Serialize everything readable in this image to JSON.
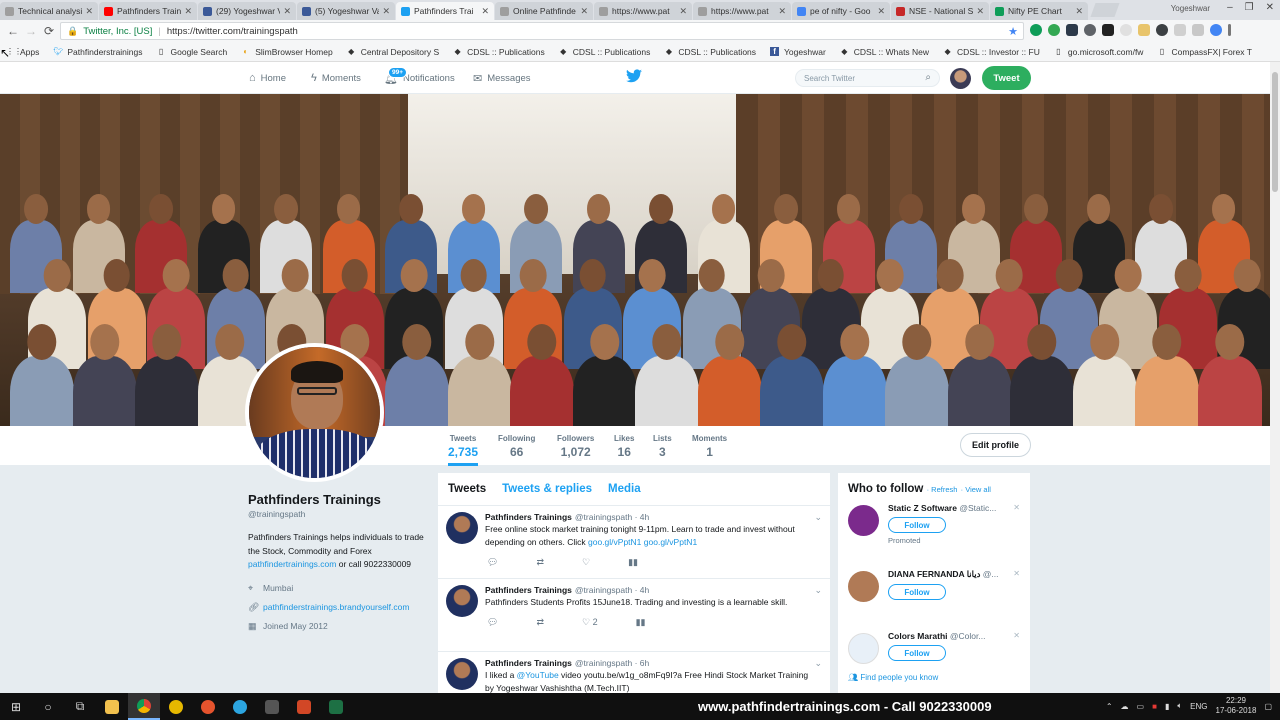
{
  "browser": {
    "tabs": [
      {
        "label": "Technical analysis",
        "icon_color": "#9e9e9e",
        "active": false
      },
      {
        "label": "Pathfinders Train",
        "icon_color": "#ff0000",
        "active": false
      },
      {
        "label": "(29) Yogeshwar V",
        "icon_color": "#3b5998",
        "active": false
      },
      {
        "label": "(5) Yogeshwar Va",
        "icon_color": "#3b5998",
        "active": false
      },
      {
        "label": "Pathfinders Trai",
        "icon_color": "#1da1f2",
        "active": true
      },
      {
        "label": "Online Pathfinde",
        "icon_color": "#9e9e9e",
        "active": false
      },
      {
        "label": "https://www.pat",
        "icon_color": "#9e9e9e",
        "active": false
      },
      {
        "label": "https://www.pat",
        "icon_color": "#9e9e9e",
        "active": false
      },
      {
        "label": "pe of nifty - Goo",
        "icon_color": "#4285f4",
        "active": false
      },
      {
        "label": "NSE - National S",
        "icon_color": "#c62828",
        "active": false
      },
      {
        "label": "Nifty PE Chart",
        "icon_color": "#0f9d58",
        "active": false
      }
    ],
    "profile_name": "Yogeshwar",
    "window_controls": [
      "–",
      "❐",
      "✕"
    ],
    "url_secure_label": "Twitter, Inc. [US]",
    "url": "https://twitter.com/trainingspath",
    "bookmarks": [
      {
        "label": "Apps",
        "icon": "apps-grid-icon"
      },
      {
        "label": "Pathfinderstrainings",
        "icon": "twitter-icon"
      },
      {
        "label": "Google Search",
        "icon": "page-icon"
      },
      {
        "label": "SlimBrowser Homep",
        "icon": "slimbrowser-icon"
      },
      {
        "label": "Central Depository S",
        "icon": "diamond-icon"
      },
      {
        "label": "CDSL :: Publications",
        "icon": "diamond-icon"
      },
      {
        "label": "CDSL :: Publications",
        "icon": "diamond-icon"
      },
      {
        "label": "CDSL :: Publications",
        "icon": "diamond-icon"
      },
      {
        "label": "Yogeshwar",
        "icon": "facebook-icon"
      },
      {
        "label": "CDSL :: Whats New",
        "icon": "diamond-icon"
      },
      {
        "label": "CDSL :: Investor :: FU",
        "icon": "diamond-icon"
      },
      {
        "label": "go.microsoft.com/fw",
        "icon": "page-icon"
      },
      {
        "label": "CompassFX| Forex T",
        "icon": "page-icon"
      }
    ]
  },
  "twitter_nav": {
    "home": "Home",
    "moments": "Moments",
    "notifications": "Notifications",
    "notifications_badge": "99+",
    "messages": "Messages",
    "search_placeholder": "Search Twitter",
    "tweet_button": "Tweet"
  },
  "profile": {
    "stats": [
      {
        "label": "Tweets",
        "value": "2,735"
      },
      {
        "label": "Following",
        "value": "66"
      },
      {
        "label": "Followers",
        "value": "1,072"
      },
      {
        "label": "Likes",
        "value": "16"
      },
      {
        "label": "Lists",
        "value": "3"
      },
      {
        "label": "Moments",
        "value": "1"
      }
    ],
    "edit_profile": "Edit profile",
    "name": "Pathfinders Trainings",
    "handle": "@trainingspath",
    "bio_text": "Pathfinders Trainings helps individuals to trade the Stock, Commodity and Forex",
    "bio_link": "pathfindertrainings.com",
    "bio_tail": " or call 9022330009",
    "location": "Mumbai",
    "website": "pathfinderstrainings.brandyourself.com",
    "joined": "Joined May 2012"
  },
  "feed": {
    "tabs": [
      "Tweets",
      "Tweets & replies",
      "Media"
    ],
    "tweets": [
      {
        "name": "Pathfinders Trainings",
        "handle": "@trainingspath",
        "time": "· 4h",
        "text": "Free online stock market training tonight 9-11pm. Learn to trade and invest without depending on others. Click ",
        "links": "goo.gl/vPptN1 goo.gl/vPptN1",
        "likes": "",
        "tail": ""
      },
      {
        "name": "Pathfinders Trainings",
        "handle": "@trainingspath",
        "time": "· 4h",
        "text": "Pathfinders Students Profits 15June18. Trading and investing is a learnable skill.",
        "links": "",
        "likes": "2",
        "tail": ""
      },
      {
        "name": "Pathfinders Trainings",
        "handle": "@trainingspath",
        "time": "· 6h",
        "text": "I liked a ",
        "links": "@YouTube",
        "likes": "",
        "tail": " video youtu.be/w1g_o8mFq9I?a Free Hindi Stock Market Training by Yogeshwar Vashishtha (M.Tech.IIT)"
      }
    ]
  },
  "who_to_follow": {
    "title": "Who to follow",
    "refresh": "· Refresh",
    "view_all": "· View all",
    "items": [
      {
        "name": "Static Z Software",
        "handle": "@Static...",
        "follow": "Follow",
        "promoted": "Promoted",
        "color": "#7b2a8c"
      },
      {
        "name": "DIANA FERNANDA دیانا",
        "handle": "@...",
        "follow": "Follow",
        "promoted": "",
        "color": "#b07a56"
      },
      {
        "name": "Colors Marathi",
        "handle": "@Color...",
        "follow": "Follow",
        "promoted": "",
        "color": "#e8f0f8"
      }
    ],
    "find_people": "Find people you know"
  },
  "taskbar": {
    "promo_text": "www.pathfindertrainings.com - Call 9022330009",
    "lang": "ENG",
    "time": "22:29",
    "date": "17-06-2018"
  }
}
